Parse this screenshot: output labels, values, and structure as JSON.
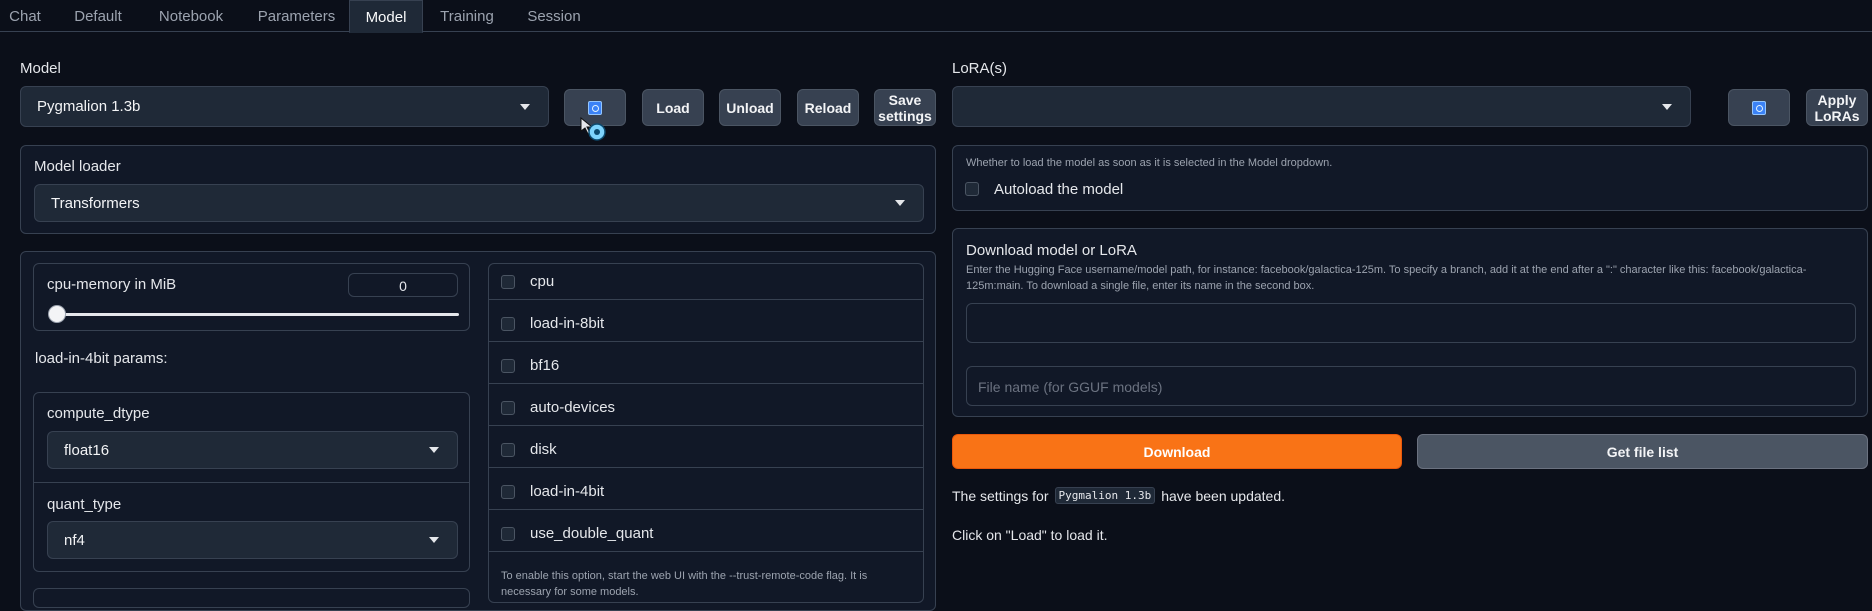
{
  "tabs": [
    "Chat",
    "Default",
    "Notebook",
    "Parameters",
    "Model",
    "Training",
    "Session"
  ],
  "active_tab": "Model",
  "model": {
    "label": "Model",
    "selected": "Pygmalion 1.3b",
    "load_label": "Load",
    "unload_label": "Unload",
    "reload_label": "Reload",
    "save_label_line1": "Save",
    "save_label_line2": "settings"
  },
  "loader": {
    "label": "Model loader",
    "selected": "Transformers"
  },
  "cpu_memory": {
    "label": "cpu-memory in MiB",
    "value": "0",
    "slider_fraction": 0
  },
  "load4bit": {
    "label": "load-in-4bit params:"
  },
  "compute_dtype": {
    "label": "compute_dtype",
    "selected": "float16"
  },
  "quant_type": {
    "label": "quant_type",
    "selected": "nf4"
  },
  "checkboxes": [
    "cpu",
    "load-in-8bit",
    "bf16",
    "auto-devices",
    "disk",
    "load-in-4bit",
    "use_double_quant"
  ],
  "trust_note": "To enable this option, start the web UI with the --trust-remote-code flag. It is necessary for some models.",
  "lora": {
    "label": "LoRA(s)",
    "selected": "",
    "apply_line1": "Apply",
    "apply_line2": "LoRAs"
  },
  "autoload": {
    "info": "Whether to load the model as soon as it is selected in the Model dropdown.",
    "label": "Autoload the model"
  },
  "download": {
    "title": "Download model or LoRA",
    "info": "Enter the Hugging Face username/model path, for instance: facebook/galactica-125m. To specify a branch, add it at the end after a \":\" character like this: facebook/galactica-125m:main. To download a single file, enter its name in the second box.",
    "path_value": "",
    "file_placeholder": "File name (for GGUF models)",
    "download_label": "Download",
    "filelist_label": "Get file list"
  },
  "status": {
    "prefix": "The settings for",
    "model_code": "Pygmalion 1.3b",
    "suffix": "have been updated.",
    "line2": "Click on \"Load\" to load it."
  },
  "colors": {
    "accent": "#f97316",
    "background": "#0b0f19",
    "panel": "#111827",
    "control": "#1f2937",
    "refresh": "#3b82f6"
  }
}
